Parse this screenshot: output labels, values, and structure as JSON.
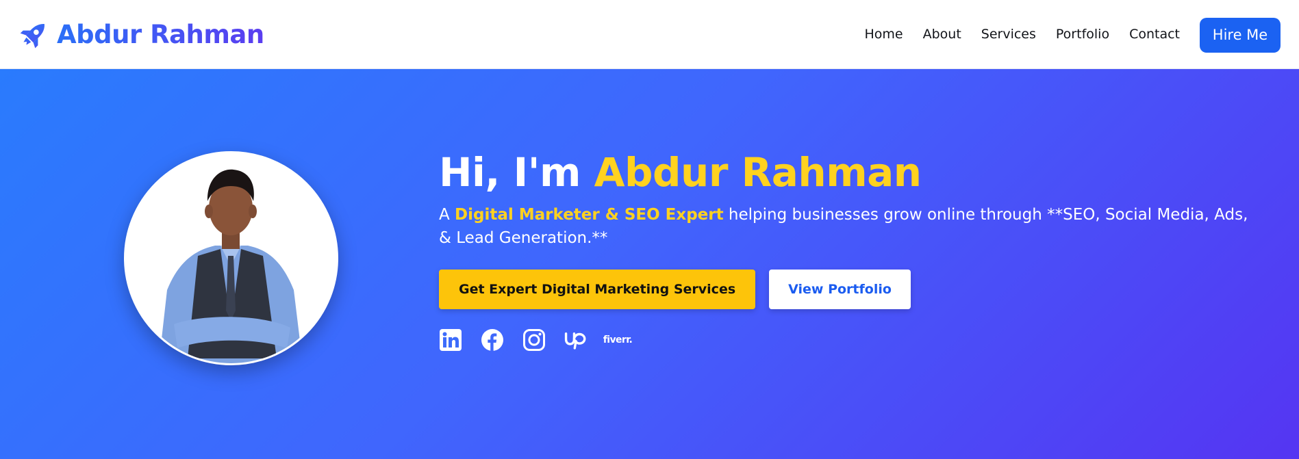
{
  "brand": {
    "name": "Abdur Rahman",
    "icon": "rocket-icon"
  },
  "nav": {
    "links": [
      "Home",
      "About",
      "Services",
      "Portfolio",
      "Contact"
    ],
    "hire_label": "Hire Me"
  },
  "hero": {
    "greeting": "Hi, I'm ",
    "name": "Abdur Rahman",
    "tagline_prefix": "A ",
    "tagline_highlight": "Digital Marketer & SEO Expert",
    "tagline_suffix": " helping businesses grow online through **SEO, Social Media, Ads, & Lead Generation.**",
    "primary_cta": "Get Expert Digital Marketing Services",
    "secondary_cta": "View Portfolio",
    "socials": [
      {
        "icon": "linkedin-icon"
      },
      {
        "icon": "facebook-icon"
      },
      {
        "icon": "instagram-icon"
      },
      {
        "icon": "upwork-icon"
      },
      {
        "icon": "fiverr-icon",
        "text": "fiverr."
      }
    ]
  },
  "colors": {
    "brand_gradient_start": "#2b6ff7",
    "brand_gradient_end": "#5b3df0",
    "accent_yellow": "#ffd21f",
    "cta_yellow": "#fdc40a",
    "hire_blue": "#1b62f2",
    "hero_gradient_start": "#2a7bfd",
    "hero_gradient_end": "#5535f2"
  }
}
